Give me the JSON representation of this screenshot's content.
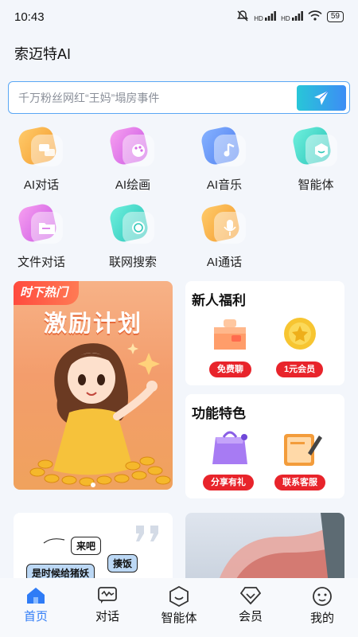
{
  "status_bar": {
    "time": "10:43",
    "signal_1": "HD",
    "signal_2": "HD",
    "battery": "59"
  },
  "app_title": "索迈特AI",
  "search": {
    "placeholder": "千万粉丝网红“王妈”塌房事件"
  },
  "features": [
    {
      "label": "AI对话",
      "icon": "chat-bubble-icon",
      "color": "#f7a43e"
    },
    {
      "label": "AI绘画",
      "icon": "palette-icon",
      "color": "#e472e0"
    },
    {
      "label": "AI音乐",
      "icon": "music-note-icon",
      "color": "#5b8df5"
    },
    {
      "label": "智能体",
      "icon": "hexagon-agent-icon",
      "color": "#3fd4c4"
    },
    {
      "label": "文件对话",
      "icon": "folder-icon",
      "color": "#e472e0"
    },
    {
      "label": "联网搜索",
      "icon": "globe-search-icon",
      "color": "#3fd4c4"
    },
    {
      "label": "AI通话",
      "icon": "microphone-icon",
      "color": "#f7a43e"
    }
  ],
  "banner": {
    "badge": "时下热门",
    "title": "激励计划"
  },
  "newcomer": {
    "title": "新人福利",
    "left_button": "免费聊",
    "right_button": "1元会员"
  },
  "features_card": {
    "title": "功能特色",
    "left_button": "分享有礼",
    "right_button": "联系客服"
  },
  "comic": {
    "bubble_1": "来吧",
    "bubble_2": "揍饭",
    "bubble_3": "是时候给猪妖"
  },
  "nav": [
    {
      "label": "首页",
      "icon": "home-icon",
      "active": true
    },
    {
      "label": "对话",
      "icon": "chat-wave-icon",
      "active": false
    },
    {
      "label": "智能体",
      "icon": "smile-hexagon-icon",
      "active": false
    },
    {
      "label": "会员",
      "icon": "diamond-icon",
      "active": false
    },
    {
      "label": "我的",
      "icon": "profile-face-icon",
      "active": false
    }
  ],
  "colors": {
    "accent": "#2f7cf6",
    "badge_red": "#e8242b"
  }
}
